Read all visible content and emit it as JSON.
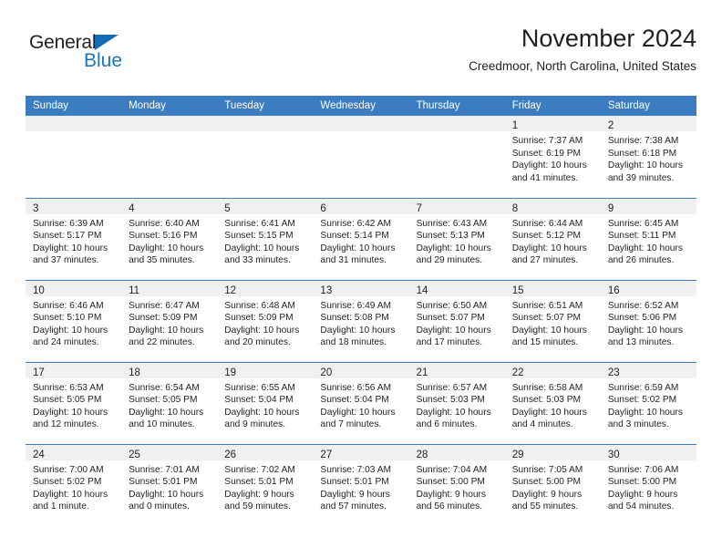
{
  "brand": {
    "name_part1": "General",
    "name_part2": "Blue",
    "primary_color": "#1b75bc",
    "triangle_color": "#156cb4",
    "logo_icon": "blue-triangle-icon"
  },
  "header": {
    "title": "November 2024",
    "subtitle": "Creedmoor, North Carolina, United States"
  },
  "calendar": {
    "header_bg": "#3b7dc0",
    "daynum_bg": "#f0f0f0",
    "weekday_headers": [
      "Sunday",
      "Monday",
      "Tuesday",
      "Wednesday",
      "Thursday",
      "Friday",
      "Saturday"
    ],
    "weeks": [
      [
        {
          "day": "",
          "lines": []
        },
        {
          "day": "",
          "lines": []
        },
        {
          "day": "",
          "lines": []
        },
        {
          "day": "",
          "lines": []
        },
        {
          "day": "",
          "lines": []
        },
        {
          "day": "1",
          "lines": [
            "Sunrise: 7:37 AM",
            "Sunset: 6:19 PM",
            "Daylight: 10 hours",
            "and 41 minutes."
          ]
        },
        {
          "day": "2",
          "lines": [
            "Sunrise: 7:38 AM",
            "Sunset: 6:18 PM",
            "Daylight: 10 hours",
            "and 39 minutes."
          ]
        }
      ],
      [
        {
          "day": "3",
          "lines": [
            "Sunrise: 6:39 AM",
            "Sunset: 5:17 PM",
            "Daylight: 10 hours",
            "and 37 minutes."
          ]
        },
        {
          "day": "4",
          "lines": [
            "Sunrise: 6:40 AM",
            "Sunset: 5:16 PM",
            "Daylight: 10 hours",
            "and 35 minutes."
          ]
        },
        {
          "day": "5",
          "lines": [
            "Sunrise: 6:41 AM",
            "Sunset: 5:15 PM",
            "Daylight: 10 hours",
            "and 33 minutes."
          ]
        },
        {
          "day": "6",
          "lines": [
            "Sunrise: 6:42 AM",
            "Sunset: 5:14 PM",
            "Daylight: 10 hours",
            "and 31 minutes."
          ]
        },
        {
          "day": "7",
          "lines": [
            "Sunrise: 6:43 AM",
            "Sunset: 5:13 PM",
            "Daylight: 10 hours",
            "and 29 minutes."
          ]
        },
        {
          "day": "8",
          "lines": [
            "Sunrise: 6:44 AM",
            "Sunset: 5:12 PM",
            "Daylight: 10 hours",
            "and 27 minutes."
          ]
        },
        {
          "day": "9",
          "lines": [
            "Sunrise: 6:45 AM",
            "Sunset: 5:11 PM",
            "Daylight: 10 hours",
            "and 26 minutes."
          ]
        }
      ],
      [
        {
          "day": "10",
          "lines": [
            "Sunrise: 6:46 AM",
            "Sunset: 5:10 PM",
            "Daylight: 10 hours",
            "and 24 minutes."
          ]
        },
        {
          "day": "11",
          "lines": [
            "Sunrise: 6:47 AM",
            "Sunset: 5:09 PM",
            "Daylight: 10 hours",
            "and 22 minutes."
          ]
        },
        {
          "day": "12",
          "lines": [
            "Sunrise: 6:48 AM",
            "Sunset: 5:09 PM",
            "Daylight: 10 hours",
            "and 20 minutes."
          ]
        },
        {
          "day": "13",
          "lines": [
            "Sunrise: 6:49 AM",
            "Sunset: 5:08 PM",
            "Daylight: 10 hours",
            "and 18 minutes."
          ]
        },
        {
          "day": "14",
          "lines": [
            "Sunrise: 6:50 AM",
            "Sunset: 5:07 PM",
            "Daylight: 10 hours",
            "and 17 minutes."
          ]
        },
        {
          "day": "15",
          "lines": [
            "Sunrise: 6:51 AM",
            "Sunset: 5:07 PM",
            "Daylight: 10 hours",
            "and 15 minutes."
          ]
        },
        {
          "day": "16",
          "lines": [
            "Sunrise: 6:52 AM",
            "Sunset: 5:06 PM",
            "Daylight: 10 hours",
            "and 13 minutes."
          ]
        }
      ],
      [
        {
          "day": "17",
          "lines": [
            "Sunrise: 6:53 AM",
            "Sunset: 5:05 PM",
            "Daylight: 10 hours",
            "and 12 minutes."
          ]
        },
        {
          "day": "18",
          "lines": [
            "Sunrise: 6:54 AM",
            "Sunset: 5:05 PM",
            "Daylight: 10 hours",
            "and 10 minutes."
          ]
        },
        {
          "day": "19",
          "lines": [
            "Sunrise: 6:55 AM",
            "Sunset: 5:04 PM",
            "Daylight: 10 hours",
            "and 9 minutes."
          ]
        },
        {
          "day": "20",
          "lines": [
            "Sunrise: 6:56 AM",
            "Sunset: 5:04 PM",
            "Daylight: 10 hours",
            "and 7 minutes."
          ]
        },
        {
          "day": "21",
          "lines": [
            "Sunrise: 6:57 AM",
            "Sunset: 5:03 PM",
            "Daylight: 10 hours",
            "and 6 minutes."
          ]
        },
        {
          "day": "22",
          "lines": [
            "Sunrise: 6:58 AM",
            "Sunset: 5:03 PM",
            "Daylight: 10 hours",
            "and 4 minutes."
          ]
        },
        {
          "day": "23",
          "lines": [
            "Sunrise: 6:59 AM",
            "Sunset: 5:02 PM",
            "Daylight: 10 hours",
            "and 3 minutes."
          ]
        }
      ],
      [
        {
          "day": "24",
          "lines": [
            "Sunrise: 7:00 AM",
            "Sunset: 5:02 PM",
            "Daylight: 10 hours",
            "and 1 minute."
          ]
        },
        {
          "day": "25",
          "lines": [
            "Sunrise: 7:01 AM",
            "Sunset: 5:01 PM",
            "Daylight: 10 hours",
            "and 0 minutes."
          ]
        },
        {
          "day": "26",
          "lines": [
            "Sunrise: 7:02 AM",
            "Sunset: 5:01 PM",
            "Daylight: 9 hours",
            "and 59 minutes."
          ]
        },
        {
          "day": "27",
          "lines": [
            "Sunrise: 7:03 AM",
            "Sunset: 5:01 PM",
            "Daylight: 9 hours",
            "and 57 minutes."
          ]
        },
        {
          "day": "28",
          "lines": [
            "Sunrise: 7:04 AM",
            "Sunset: 5:00 PM",
            "Daylight: 9 hours",
            "and 56 minutes."
          ]
        },
        {
          "day": "29",
          "lines": [
            "Sunrise: 7:05 AM",
            "Sunset: 5:00 PM",
            "Daylight: 9 hours",
            "and 55 minutes."
          ]
        },
        {
          "day": "30",
          "lines": [
            "Sunrise: 7:06 AM",
            "Sunset: 5:00 PM",
            "Daylight: 9 hours",
            "and 54 minutes."
          ]
        }
      ]
    ]
  }
}
